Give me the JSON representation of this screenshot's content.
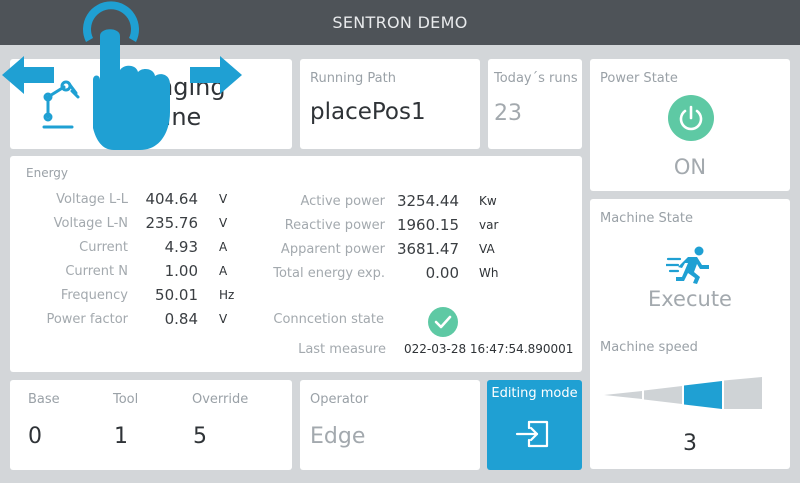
{
  "header": {
    "title": "SENTRON DEMO"
  },
  "mode_card": {
    "line1": "nging",
    "line2": "line"
  },
  "running_path": {
    "label": "Running Path",
    "value": "placePos1"
  },
  "today_runs": {
    "label": "Today´s runs",
    "value": "23"
  },
  "power_state": {
    "label": "Power State",
    "value": "ON",
    "accent": "#5ec9a4"
  },
  "energy": {
    "label": "Energy",
    "left": [
      {
        "label": "Voltage L-L",
        "value": "404.64",
        "unit": "V"
      },
      {
        "label": "Voltage L-N",
        "value": "235.76",
        "unit": "V"
      },
      {
        "label": "Current",
        "value": "4.93",
        "unit": "A"
      },
      {
        "label": "Current N",
        "value": "1.00",
        "unit": "A"
      },
      {
        "label": "Frequency",
        "value": "50.01",
        "unit": "Hz"
      },
      {
        "label": "Power factor",
        "value": "0.84",
        "unit": "V"
      }
    ],
    "right": [
      {
        "label": "Active power",
        "value": "3254.44",
        "unit": "Kw"
      },
      {
        "label": "Reactive power",
        "value": "1960.15",
        "unit": "var"
      },
      {
        "label": "Apparent power",
        "value": "3681.47",
        "unit": "VA"
      },
      {
        "label": "Total energy exp.",
        "value": "0.00",
        "unit": "Wh"
      }
    ],
    "connection_label": "Conncetion state",
    "last_measure_label": "Last measure",
    "last_measure_value": "022-03-28 16:47:54.890001"
  },
  "machine_state": {
    "label": "Machine State",
    "value": "Execute",
    "accent": "#1fa0d3"
  },
  "machine_speed": {
    "label": "Machine speed",
    "value": "3",
    "level": 3,
    "levels": 4
  },
  "tool_card": {
    "items": [
      {
        "label": "Base",
        "value": "0"
      },
      {
        "label": "Tool",
        "value": "1"
      },
      {
        "label": "Override",
        "value": "5"
      }
    ]
  },
  "operator": {
    "label": "Operator",
    "value": "Edge"
  },
  "editing_mode": {
    "label": "Editing mode",
    "accent": "#1fa0d3"
  },
  "icons": [
    "robot-arm-icon",
    "hand-pointer-icon",
    "power-icon",
    "check-circle-icon",
    "runner-icon",
    "login-icon"
  ]
}
